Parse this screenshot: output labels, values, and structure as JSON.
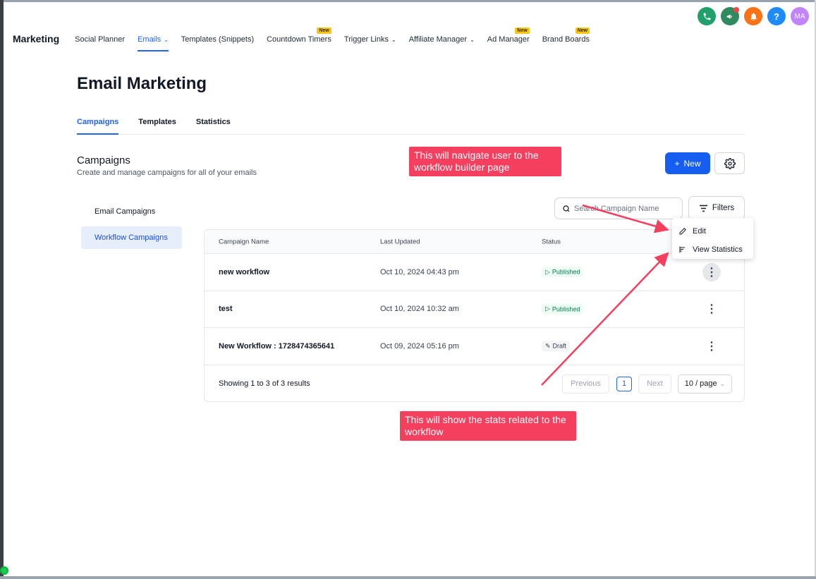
{
  "top_icons": [
    {
      "name": "phone-icon",
      "color": "#22a06b",
      "glyph": "✆"
    },
    {
      "name": "megaphone-icon",
      "color": "#2f8a60",
      "glyph": "📢"
    },
    {
      "name": "bell-icon",
      "color": "#f97316",
      "glyph": "🔔"
    },
    {
      "name": "help-icon",
      "color": "#1d8cf8",
      "glyph": "?"
    },
    {
      "name": "avatar",
      "color": "#c084fc",
      "glyph": "MA"
    }
  ],
  "nav": {
    "brand": "Marketing",
    "items": [
      {
        "label": "Social Planner"
      },
      {
        "label": "Emails"
      },
      {
        "label": "Templates (Snippets)"
      },
      {
        "label": "Countdown Timers",
        "badge": "New"
      },
      {
        "label": "Trigger Links"
      },
      {
        "label": "Affiliate Manager"
      },
      {
        "label": "Ad Manager",
        "badge": "New"
      },
      {
        "label": "Brand Boards",
        "badge": "New"
      }
    ]
  },
  "page_title": "Email Marketing",
  "tabs": [
    "Campaigns",
    "Templates",
    "Statistics"
  ],
  "section": {
    "title": "Campaigns",
    "subtitle": "Create and manage campaigns for all of your emails",
    "new_label": "New"
  },
  "sidebar": [
    "Email Campaigns",
    "Workflow Campaigns"
  ],
  "search": {
    "placeholder": "Search Campaign Name"
  },
  "filters_label": "Filters",
  "table": {
    "headers": [
      "Campaign Name",
      "Last Updated",
      "Status"
    ],
    "rows": [
      {
        "name": "new workflow",
        "updated": "Oct 10, 2024 04:43 pm",
        "status": "Published"
      },
      {
        "name": "test",
        "updated": "Oct 10, 2024 10:32 am",
        "status": "Published"
      },
      {
        "name": "New Workflow : 1728474365641",
        "updated": "Oct 09, 2024 05:16 pm",
        "status": "Draft"
      }
    ],
    "footer": "Showing 1 to 3 of 3 results",
    "pagination": {
      "previous": "Previous",
      "page": "1",
      "next": "Next",
      "per_page": "10 / page"
    }
  },
  "dropdown": [
    "Edit",
    "View Statistics"
  ],
  "callouts": {
    "top": "This will navigate user to the workflow builder page",
    "bottom": "This will show the stats related to the workflow"
  },
  "colors": {
    "accent": "#155eef",
    "callout": "#f43f5e"
  }
}
